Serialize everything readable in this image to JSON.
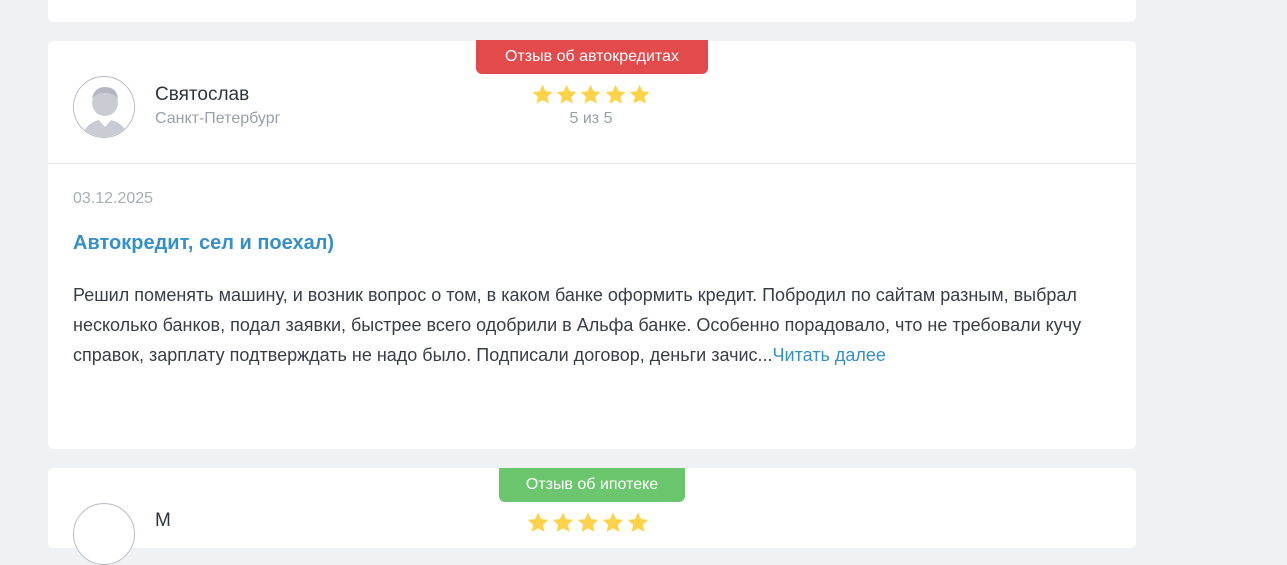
{
  "review": {
    "badge": "Отзыв об автокредитах",
    "author_name": "Святослав",
    "author_city": "Санкт-Петербург",
    "rating": 5,
    "rating_text": "5 из 5",
    "date": "03.12.2025",
    "title": "Автокредит, сел и поехал)",
    "text": "Решил поменять машину, и возник вопрос о том, в каком банке оформить кредит. Побродил по сайтам разным, выбрал несколько банков, подал заявки, быстрее всего одобрили в Альфа банке. Особенно порадовало, что не требовали кучу справок, зарплату подтверждать не надо было. Подписали договор, деньги зачис...",
    "read_more": "Читать далее"
  },
  "next_review": {
    "badge": "Отзыв об ипотеке",
    "author_name": "М",
    "rating": 5
  },
  "colors": {
    "badge_autocredit": "#e34a4c",
    "badge_mortgage": "#6cc66d",
    "star": "#ffd24a",
    "link": "#3690c8"
  },
  "icons": {
    "avatar": "user-silhouette-icon",
    "star": "star-icon"
  }
}
